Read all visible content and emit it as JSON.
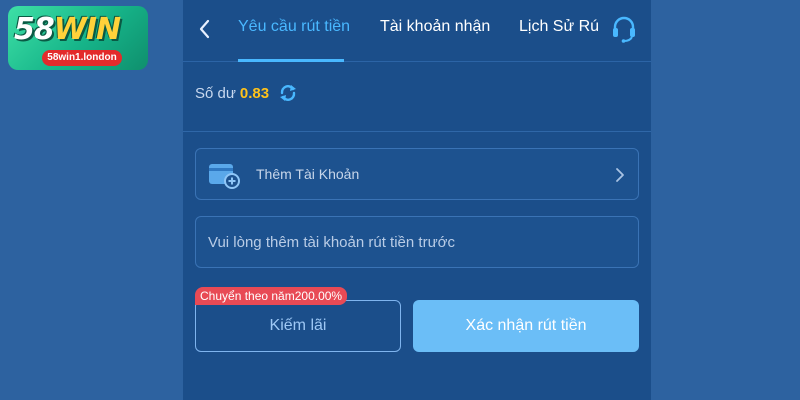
{
  "logo": {
    "brand_number": "58",
    "brand_word": "WIN",
    "domain": "58win1.london"
  },
  "topbar": {
    "back_icon": "chevron-left-icon",
    "tabs": [
      {
        "label": "Yêu cầu rút tiền",
        "active": true
      },
      {
        "label": "Tài khoản nhận",
        "active": false
      },
      {
        "label": "Lịch Sử Rú",
        "active": false
      }
    ],
    "support_icon": "headset-icon",
    "active_color": "#49b8ff"
  },
  "balance": {
    "label": "Số dư",
    "value": "0.83",
    "value_color": "#ffc21a",
    "refresh_icon": "refresh-icon"
  },
  "add_account": {
    "label": "Thêm Tài Khoản",
    "icon": "wallet-add-icon",
    "chevron_icon": "chevron-right-icon"
  },
  "info_field": {
    "text": "Vui lòng thêm tài khoản rút tiền trước"
  },
  "earn_button": {
    "label": "Kiếm lãi",
    "badge": "Chuyển theo năm200.00%",
    "badge_color": "#e84a55"
  },
  "confirm_button": {
    "label": "Xác nhận rút tiền",
    "color": "#6bbef7"
  }
}
